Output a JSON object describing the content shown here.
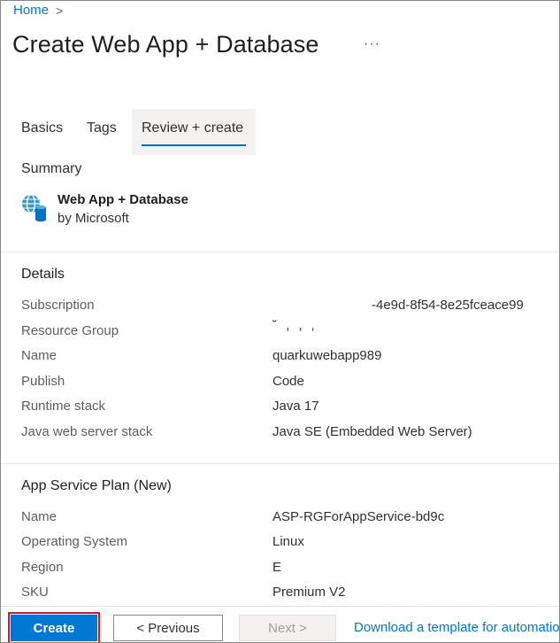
{
  "breadcrumb": {
    "home": "Home",
    "separator": ">"
  },
  "page": {
    "title": "Create Web App + Database",
    "more": "···"
  },
  "tabs": [
    {
      "label": "Basics"
    },
    {
      "label": "Tags"
    },
    {
      "label": "Review + create"
    }
  ],
  "summary": {
    "label": "Summary",
    "product_name": "Web App + Database",
    "product_by": "by Microsoft",
    "icon": "web-app-database-icon"
  },
  "details": {
    "title": "Details",
    "rows": [
      {
        "key": "Subscription",
        "value": "-4e9d-8f54-8e25fceace99"
      },
      {
        "key": "Resource Group",
        "value": "˘   ,    ,  ‚"
      },
      {
        "key": "Name",
        "value": "quarkuwebapp989"
      },
      {
        "key": "Publish",
        "value": "Code"
      },
      {
        "key": "Runtime stack",
        "value": "Java 17"
      },
      {
        "key": "Java web server stack",
        "value": "Java SE (Embedded Web Server)"
      }
    ]
  },
  "plan": {
    "title": "App Service Plan (New)",
    "rows": [
      {
        "key": "Name",
        "value": "ASP-RGForAppService-bd9c"
      },
      {
        "key": "Operating System",
        "value": "Linux"
      },
      {
        "key": "Region",
        "value": "E"
      },
      {
        "key": "SKU",
        "value": "Premium V2"
      }
    ]
  },
  "footer": {
    "create": "Create",
    "previous": "< Previous",
    "next": "Next >",
    "download": "Download a template for automation"
  },
  "colors": {
    "accent": "#0078d4",
    "highlight": "#e81123"
  }
}
